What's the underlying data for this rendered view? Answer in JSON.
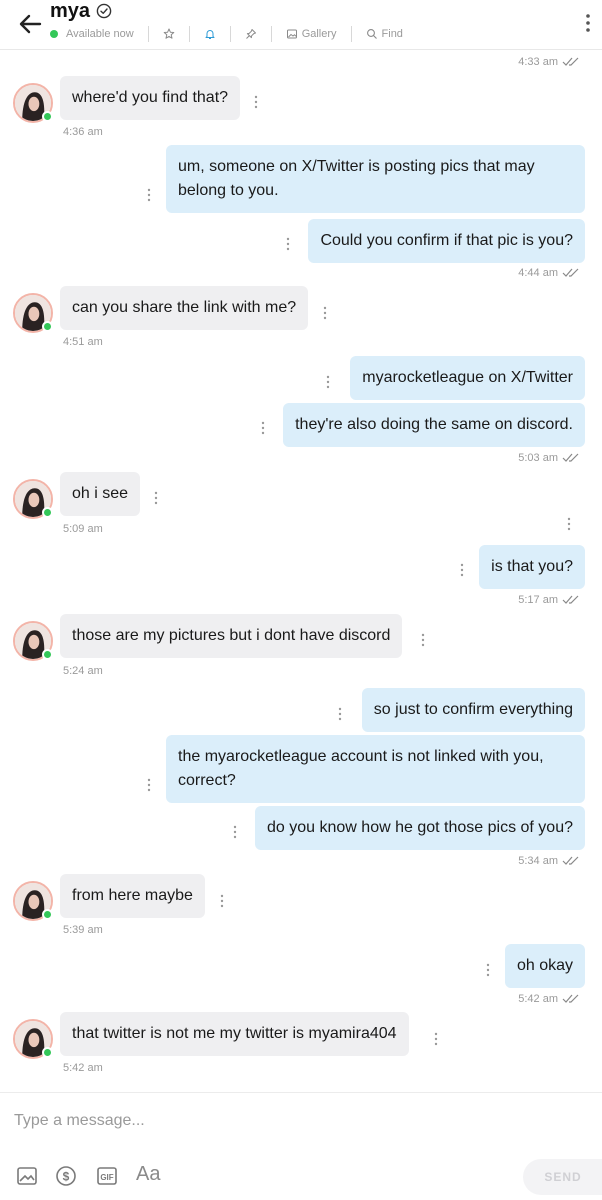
{
  "header": {
    "name": "mya",
    "status": "Available now",
    "gallery_label": "Gallery",
    "find_label": "Find"
  },
  "first_time": "4:33 am",
  "messages": [
    {
      "from": "them",
      "text": "where'd you find that?",
      "time": "4:36 am"
    },
    {
      "from": "me",
      "text": "um, someone on X/Twitter is posting pics that may\nbelong to you."
    },
    {
      "from": "me",
      "text": "Could you confirm if that pic is you?",
      "time": "4:44 am"
    },
    {
      "from": "them",
      "text": "can you share the link with me?",
      "time": "4:51 am"
    },
    {
      "from": "me",
      "text": "myarocketleague on X/Twitter"
    },
    {
      "from": "me",
      "text": "they're also doing the same on discord.",
      "time": "5:03 am"
    },
    {
      "from": "them",
      "text": "oh i see",
      "time": "5:09 am"
    },
    {
      "from": "me",
      "text": "is that you?",
      "time": "5:17 am"
    },
    {
      "from": "them",
      "text": "those are my pictures but i dont have discord",
      "time": "5:24 am"
    },
    {
      "from": "me",
      "text": "so just to confirm everything"
    },
    {
      "from": "me",
      "text": "the myarocketleague account is not linked with you,\ncorrect?"
    },
    {
      "from": "me",
      "text": "do you know how he got those pics of you?",
      "time": "5:34 am"
    },
    {
      "from": "them",
      "text": "from here maybe",
      "time": "5:39 am"
    },
    {
      "from": "me",
      "text": "oh okay",
      "time": "5:42 am"
    },
    {
      "from": "them",
      "text": "that twitter is not me my twitter is myamira404",
      "time": "5:42 am"
    }
  ],
  "composer": {
    "placeholder": "Type a message...",
    "text_format_label": "Aa",
    "send_label": "SEND"
  },
  "colors": {
    "incoming_bubble": "#efeff1",
    "outgoing_bubble": "#dbeefa",
    "online": "#34c759",
    "meta_text": "#9a9a9a"
  }
}
